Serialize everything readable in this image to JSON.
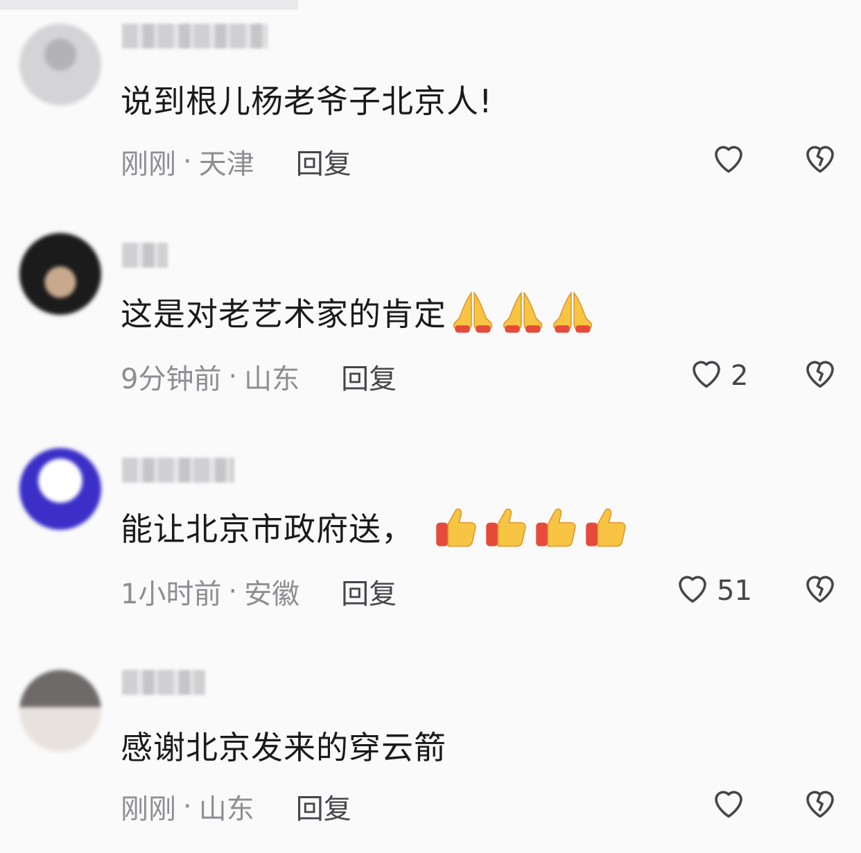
{
  "comments": [
    {
      "text": "说到根儿杨老爷子北京人!",
      "time": "刚刚",
      "location": "天津",
      "reply_label": "回复",
      "likes": "",
      "emoji": [],
      "avatar_colors": [
        "#d2d2d4",
        "#a9a9ac"
      ]
    },
    {
      "text": "这是对老艺术家的肯定",
      "time": "9分钟前",
      "location": "山东",
      "reply_label": "回复",
      "likes": "2",
      "emoji": [
        "folded-hands-icon",
        "folded-hands-icon",
        "folded-hands-icon"
      ],
      "avatar_colors": [
        "#1b1b1b",
        "#c8a98e"
      ]
    },
    {
      "text": "能让北京市政府送，",
      "time": "1小时前",
      "location": "安徽",
      "reply_label": "回复",
      "likes": "51",
      "emoji": [
        "thumbs-up-icon",
        "thumbs-up-icon",
        "thumbs-up-icon",
        "thumbs-up-icon"
      ],
      "avatar_colors": [
        "#3b2fc8",
        "#ffffff"
      ]
    },
    {
      "text": "感谢北京发来的穿云箭",
      "time": "刚刚",
      "location": "山东",
      "reply_label": "回复",
      "likes": "",
      "emoji": [],
      "avatar_colors": [
        "#6e6a6a",
        "#e8e2de"
      ]
    }
  ],
  "separator": "·",
  "icons": {
    "like": "heart-outline-icon",
    "dislike": "broken-heart-icon"
  },
  "colors": {
    "text": "#1a1a1a",
    "meta": "#8d8d92",
    "action": "#45454a",
    "background": "#fafafa"
  }
}
